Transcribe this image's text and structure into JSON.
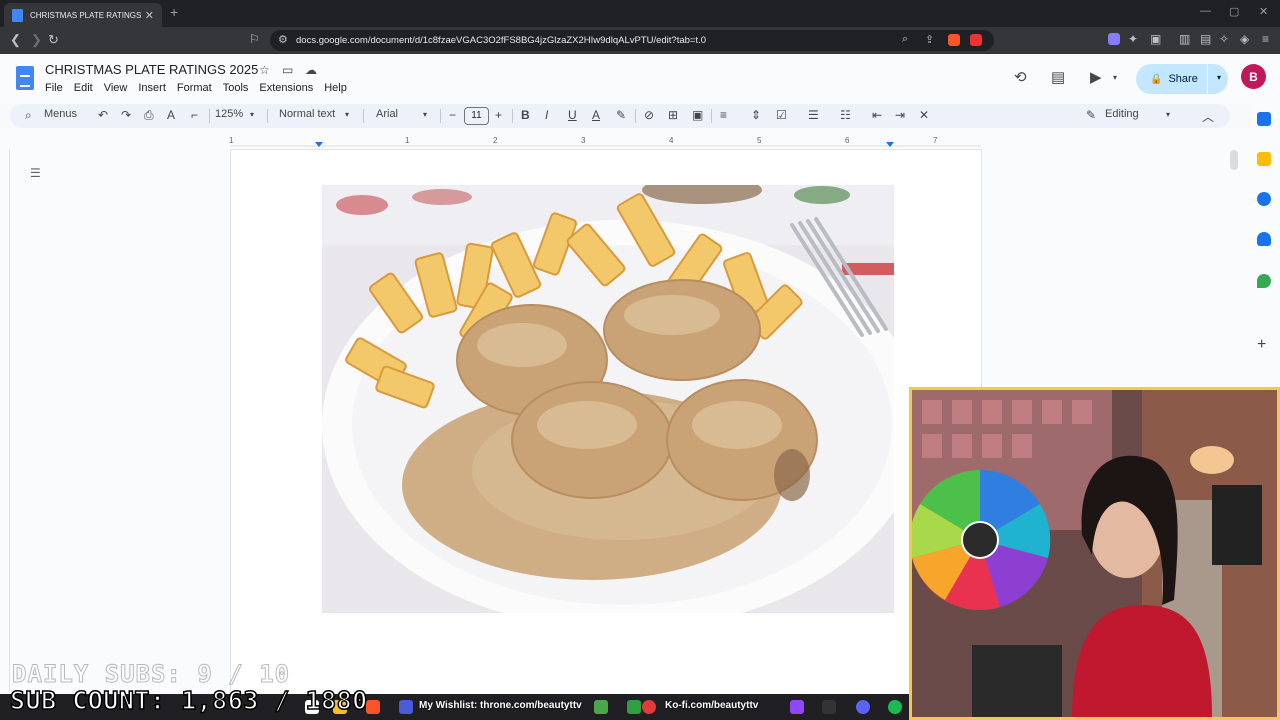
{
  "browser": {
    "tab_title": "CHRISTMAS PLATE RATINGS 20...",
    "url": "docs.google.com/document/d/1c8fzaeVGAC3O2fFS8BG4jzGlzaZX2HIw9dlqALvPTU/edit?tab=t.0"
  },
  "doc": {
    "title": "CHRISTMAS PLATE RATINGS 2025",
    "menus": [
      "File",
      "Edit",
      "View",
      "Insert",
      "Format",
      "Tools",
      "Extensions",
      "Help"
    ],
    "share_label": "Share",
    "avatar_letter": "B"
  },
  "toolbar": {
    "menus_label": "Menus",
    "zoom": "125%",
    "style": "Normal text",
    "font": "Arial",
    "font_size": "11",
    "mode": "Editing"
  },
  "ruler": {
    "numbers": [
      "1",
      "1",
      "2",
      "3",
      "4",
      "5",
      "6",
      "7"
    ]
  },
  "overlay": {
    "daily_subs": "DAILY SUBS: 9 / 10",
    "sub_count": "SUB COUNT: 1,863 / 1880"
  },
  "taskbar": {
    "wishlist_label": "My Wishlist: throne.com/beautyttv",
    "kofi_label": "Ko-fi.com/beautyttv"
  },
  "colors": {
    "accent": "#1a73e8",
    "share_bg": "#c2e7ff",
    "cam_border": "#f6c94a"
  }
}
